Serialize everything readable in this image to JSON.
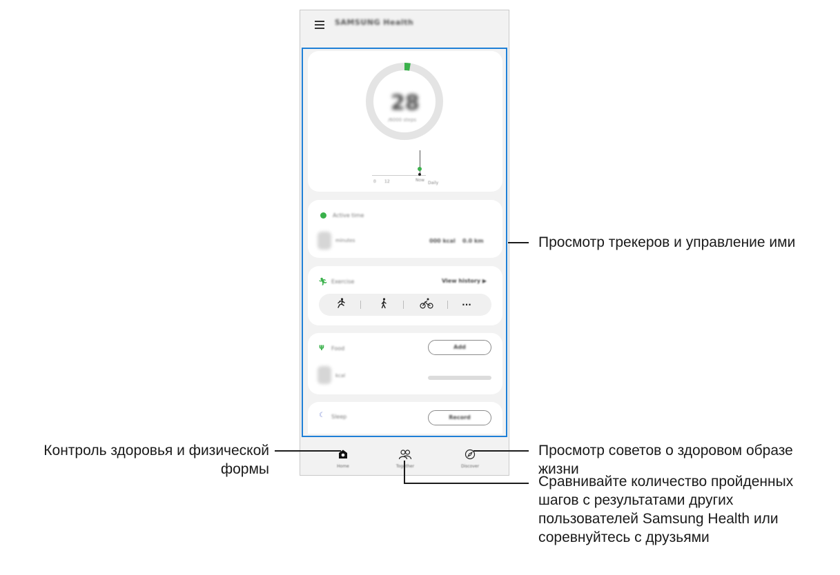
{
  "app": {
    "title": "SAMSUNG Health"
  },
  "steps_card": {
    "value": "28",
    "subtitle": "/6000 steps",
    "graph_labels": [
      "0",
      "12",
      "Now",
      "Daily"
    ]
  },
  "active_time_card": {
    "title": "Active time",
    "value_label": "minutes",
    "stat_1": "000 kcal",
    "stat_2": "0.0 km"
  },
  "exercise_card": {
    "title": "Exercise",
    "link": "View history ▶",
    "more": "···"
  },
  "food_card": {
    "title": "Food",
    "button": "Add",
    "value_label": "kcal"
  },
  "sleep_card": {
    "title": "Sleep",
    "button": "Record"
  },
  "nav": {
    "home": "Home",
    "together": "Together",
    "discover": "Discover"
  },
  "callouts": {
    "trackers": "Просмотр трекеров и управление ими",
    "health_line1": "Контроль здоровья и физической",
    "health_line2": "формы",
    "tips_line1": "Просмотр советов о здоровом образе",
    "tips_line2": "жизни",
    "compare_line1": "Сравнивайте количество пройденных",
    "compare_line2": "шагов с результатами других",
    "compare_line3": "пользователей Samsung Health или",
    "compare_line4": "соревнуйтесь с друзьями"
  },
  "colors": {
    "accent_green": "#3ab14b",
    "highlight_blue": "#1e7fd6",
    "sleep_blue": "#7b8cd6"
  }
}
